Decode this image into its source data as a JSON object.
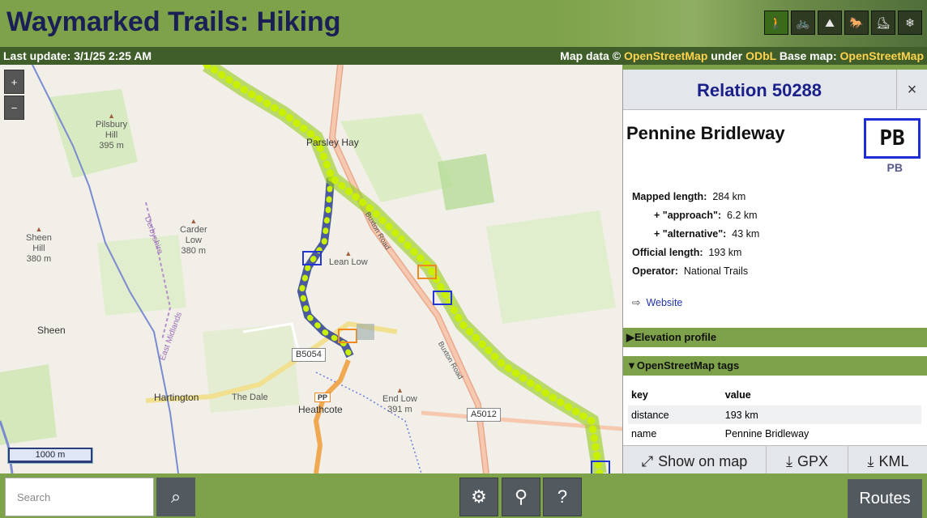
{
  "header": {
    "title": "Waymarked Trails: Hiking",
    "route_types": [
      {
        "name": "hiking",
        "icon": "hiker-icon",
        "glyph": "🚶"
      },
      {
        "name": "cycling",
        "icon": "bicycle-icon",
        "glyph": "🚲"
      },
      {
        "name": "mtb",
        "icon": "mountain-bike-icon",
        "glyph": "⛰"
      },
      {
        "name": "riding",
        "icon": "horse-icon",
        "glyph": "🐎"
      },
      {
        "name": "skating",
        "icon": "skater-icon",
        "glyph": "⛸"
      },
      {
        "name": "slopes",
        "icon": "snowflake-icon",
        "glyph": "❄"
      }
    ]
  },
  "status": {
    "last_update": "Last update: 3/1/25 2:25 AM",
    "map_data_prefix": "Map data © ",
    "osm": "OpenStreetMap",
    "under": " under ",
    "odbl": "ODbL",
    "base_map": " Base map: ",
    "base_osm": "OpenStreetMap"
  },
  "map": {
    "zoom_in": "+",
    "zoom_out": "−",
    "scale": "1000 m",
    "labels": {
      "pilsbury": "Pilsbury\nHill\n395 m",
      "parsley_hay": "Parsley Hay",
      "carder_low": "Carder\nLow\n380 m",
      "sheen_hill": "Sheen\nHill\n380 m",
      "lean_low": "Lean Low",
      "sheen": "Sheen",
      "hartington": "Hartington",
      "end_low": "End Low\n391 m",
      "heathcote": "Heathcote",
      "b5054": "B5054",
      "a5012": "A5012",
      "buxton_road": "Buxton Road",
      "the_dale": "The Dale",
      "derbyshire": "Derbyshire",
      "east_midlands": "East Midlands",
      "pp": "PP"
    }
  },
  "sidebar": {
    "title": "Relation 50288",
    "close": "×",
    "route_name": "Pennine Bridleway",
    "shield_text": "PB",
    "shield_ref": "PB",
    "details": {
      "mapped_length_label": "Mapped length:",
      "mapped_length": "284 km",
      "approach_label": "+ \"approach\":",
      "approach": "6.2 km",
      "alternative_label": "+ \"alternative\":",
      "alternative": "43 km",
      "official_length_label": "Official length:",
      "official_length": "193 km",
      "operator_label": "Operator:",
      "operator": "National Trails"
    },
    "website": "Website",
    "elevation_profile": "Elevation profile",
    "osm_tags": "OpenStreetMap tags",
    "tags_header": {
      "key": "key",
      "value": "value"
    },
    "tags": [
      {
        "key": "distance",
        "value": "193 km"
      },
      {
        "key": "name",
        "value": "Pennine Bridleway"
      }
    ],
    "actions": {
      "show_on_map": "Show on map",
      "gpx": "GPX",
      "kml": "KML"
    }
  },
  "footer": {
    "search_placeholder": "Search",
    "routes": "Routes"
  },
  "colors": {
    "header_green": "#7ea24a",
    "title_blue": "#1a1f55",
    "route_highlight": "#c8f000",
    "route_blue": "#2e3f8f",
    "link_yellow": "#ffd34d"
  }
}
